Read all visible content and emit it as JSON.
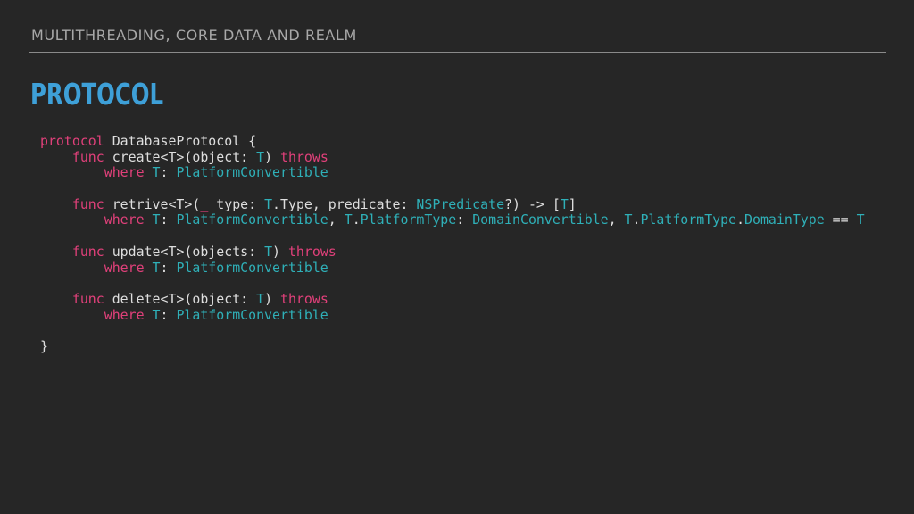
{
  "colors": {
    "background": "#262626",
    "header_text": "#a8a8a8",
    "title": "#3ea0d8",
    "keyword": "#e0407a",
    "type": "#2fb0b8",
    "plain": "#dedede"
  },
  "header": {
    "text": "MULTITHREADING, CORE DATA AND REALM"
  },
  "title": {
    "text": "PROTOCOL"
  },
  "code": {
    "language": "swift",
    "lines": [
      [
        {
          "t": "protocol",
          "s": "kw"
        },
        {
          "t": " DatabaseProtocol {",
          "s": "pl"
        }
      ],
      [
        {
          "t": "    ",
          "s": "pl"
        },
        {
          "t": "func",
          "s": "kw"
        },
        {
          "t": " create<T>(object: ",
          "s": "pl"
        },
        {
          "t": "T",
          "s": "ty"
        },
        {
          "t": ") ",
          "s": "pl"
        },
        {
          "t": "throws",
          "s": "kw"
        }
      ],
      [
        {
          "t": "        ",
          "s": "pl"
        },
        {
          "t": "where",
          "s": "kw"
        },
        {
          "t": " ",
          "s": "pl"
        },
        {
          "t": "T",
          "s": "ty"
        },
        {
          "t": ": ",
          "s": "pl"
        },
        {
          "t": "PlatformConvertible",
          "s": "ty"
        }
      ],
      [],
      [
        {
          "t": "    ",
          "s": "pl"
        },
        {
          "t": "func",
          "s": "kw"
        },
        {
          "t": " retrive<T>(",
          "s": "pl"
        },
        {
          "t": "_",
          "s": "kw"
        },
        {
          "t": " type: ",
          "s": "pl"
        },
        {
          "t": "T",
          "s": "ty"
        },
        {
          "t": ".Type, predicate: ",
          "s": "pl"
        },
        {
          "t": "NSPredicate",
          "s": "ty"
        },
        {
          "t": "?) -> [",
          "s": "pl"
        },
        {
          "t": "T",
          "s": "ty"
        },
        {
          "t": "]",
          "s": "pl"
        }
      ],
      [
        {
          "t": "        ",
          "s": "pl"
        },
        {
          "t": "where",
          "s": "kw"
        },
        {
          "t": " ",
          "s": "pl"
        },
        {
          "t": "T",
          "s": "ty"
        },
        {
          "t": ": ",
          "s": "pl"
        },
        {
          "t": "PlatformConvertible",
          "s": "ty"
        },
        {
          "t": ", ",
          "s": "pl"
        },
        {
          "t": "T",
          "s": "ty"
        },
        {
          "t": ".",
          "s": "pl"
        },
        {
          "t": "PlatformType",
          "s": "ty"
        },
        {
          "t": ": ",
          "s": "pl"
        },
        {
          "t": "DomainConvertible",
          "s": "ty"
        },
        {
          "t": ", ",
          "s": "pl"
        },
        {
          "t": "T",
          "s": "ty"
        },
        {
          "t": ".",
          "s": "pl"
        },
        {
          "t": "PlatformType",
          "s": "ty"
        },
        {
          "t": ".",
          "s": "pl"
        },
        {
          "t": "DomainType",
          "s": "ty"
        },
        {
          "t": " == ",
          "s": "pl"
        },
        {
          "t": "T",
          "s": "ty"
        }
      ],
      [],
      [
        {
          "t": "    ",
          "s": "pl"
        },
        {
          "t": "func",
          "s": "kw"
        },
        {
          "t": " update<T>(objects: ",
          "s": "pl"
        },
        {
          "t": "T",
          "s": "ty"
        },
        {
          "t": ") ",
          "s": "pl"
        },
        {
          "t": "throws",
          "s": "kw"
        }
      ],
      [
        {
          "t": "        ",
          "s": "pl"
        },
        {
          "t": "where",
          "s": "kw"
        },
        {
          "t": " ",
          "s": "pl"
        },
        {
          "t": "T",
          "s": "ty"
        },
        {
          "t": ": ",
          "s": "pl"
        },
        {
          "t": "PlatformConvertible",
          "s": "ty"
        }
      ],
      [],
      [
        {
          "t": "    ",
          "s": "pl"
        },
        {
          "t": "func",
          "s": "kw"
        },
        {
          "t": " delete<T>(object: ",
          "s": "pl"
        },
        {
          "t": "T",
          "s": "ty"
        },
        {
          "t": ") ",
          "s": "pl"
        },
        {
          "t": "throws",
          "s": "kw"
        }
      ],
      [
        {
          "t": "        ",
          "s": "pl"
        },
        {
          "t": "where",
          "s": "kw"
        },
        {
          "t": " ",
          "s": "pl"
        },
        {
          "t": "T",
          "s": "ty"
        },
        {
          "t": ": ",
          "s": "pl"
        },
        {
          "t": "PlatformConvertible",
          "s": "ty"
        }
      ],
      [],
      [
        {
          "t": "}",
          "s": "pl"
        }
      ]
    ]
  }
}
